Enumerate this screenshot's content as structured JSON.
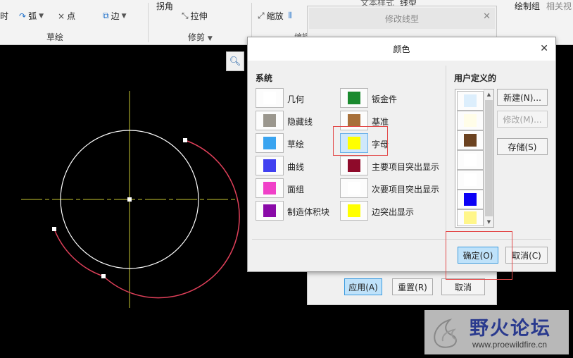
{
  "ribbon": {
    "items": [
      {
        "id": "cut",
        "label": "时"
      },
      {
        "id": "arc",
        "label": "弧"
      },
      {
        "id": "point",
        "label": "点"
      },
      {
        "id": "edge",
        "label": "边"
      },
      {
        "id": "corner",
        "label": "拐角"
      },
      {
        "id": "stretch",
        "label": "拉伸"
      },
      {
        "id": "scale",
        "label": "缩放"
      },
      {
        "id": "draw-group",
        "label": "绘制组"
      },
      {
        "id": "related-view",
        "label": "相关视"
      },
      {
        "id": "text-style",
        "label": "文本样式"
      },
      {
        "id": "linetype",
        "label": "线型"
      },
      {
        "id": "edit",
        "label": "编辑"
      }
    ],
    "groups": {
      "sketch": "草绘",
      "trim": "修剪"
    }
  },
  "linetype_dialog": {
    "title": "修改线型",
    "apply_label": "应用(A)",
    "reset_label": "重置(R)",
    "cancel_label": "取消"
  },
  "color_dialog": {
    "title": "颜色",
    "system_label": "系统",
    "user_defined_label": "用户定义的",
    "system_colors_left": [
      {
        "label": "几何",
        "color": "#ffffff"
      },
      {
        "label": "隐藏线",
        "color": "#9b978e"
      },
      {
        "label": "草绘",
        "color": "#3aa4f0"
      },
      {
        "label": "曲线",
        "color": "#4040f0"
      },
      {
        "label": "面组",
        "color": "#f040c8"
      },
      {
        "label": "制造体积块",
        "color": "#8a0aa8"
      }
    ],
    "system_colors_right": [
      {
        "label": "钣金件",
        "color": "#1a8a2e"
      },
      {
        "label": "基准",
        "color": "#a8703a"
      },
      {
        "label": "字母",
        "color": "#ffff00"
      },
      {
        "label": "主要项目突出显示",
        "color": "#8e0a2a"
      },
      {
        "label": "次要项目突出显示",
        "color": "#ffffff"
      },
      {
        "label": "边突出显示",
        "color": "#ffff00"
      }
    ],
    "selected_color": "字母",
    "user_colors": [
      "#dceefc",
      "#fffde8",
      "#6b4220",
      "#ffffff",
      "#ffffff",
      "#0b00f5",
      "#fff68a"
    ],
    "new_label": "新建(N)...",
    "modify_label": "修改(M)...",
    "save_label": "存储(S)",
    "ok_label": "确定(O)",
    "cancel_label": "取消(C)"
  },
  "watermark": {
    "name": "野火论坛",
    "url": "www.proewildfire.cn"
  },
  "colors": {
    "canvas_bg": "#000000",
    "circle": "#ffffff",
    "arc": "#e0405a",
    "centerline": "#c8c832",
    "highlight_box": "#e34a4a"
  }
}
